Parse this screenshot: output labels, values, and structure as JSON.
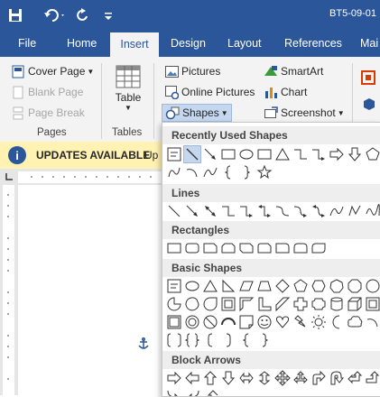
{
  "titlebar": {
    "document_title": "BT5-09-01",
    "qat": [
      "save-icon",
      "undo-icon",
      "redo-icon",
      "customize-icon"
    ]
  },
  "tabs": [
    {
      "label": "File"
    },
    {
      "label": "Home"
    },
    {
      "label": "Insert",
      "active": true
    },
    {
      "label": "Design"
    },
    {
      "label": "Layout"
    },
    {
      "label": "References"
    },
    {
      "label": "Mai"
    }
  ],
  "ribbon": {
    "pages_group": {
      "label": "Pages",
      "cover_page": "Cover Page",
      "blank_page": "Blank Page",
      "page_break": "Page Break"
    },
    "tables_group": {
      "label": "Tables",
      "table": "Table"
    },
    "illustrations": {
      "pictures": "Pictures",
      "online_pictures": "Online Pictures",
      "shapes": "Shapes",
      "smartart": "SmartArt",
      "chart": "Chart",
      "screenshot": "Screenshot"
    }
  },
  "update_bar": {
    "title": "UPDATES AVAILABLE",
    "message_start": "Up"
  },
  "shapes_gallery": {
    "sections": [
      {
        "title": "Recently Used Shapes"
      },
      {
        "title": "Lines"
      },
      {
        "title": "Rectangles"
      },
      {
        "title": "Basic Shapes"
      },
      {
        "title": "Block Arrows"
      }
    ]
  },
  "colors": {
    "accent": "#2b579a",
    "update_bar": "#fff2b3",
    "selection": "#c5d7ee"
  }
}
